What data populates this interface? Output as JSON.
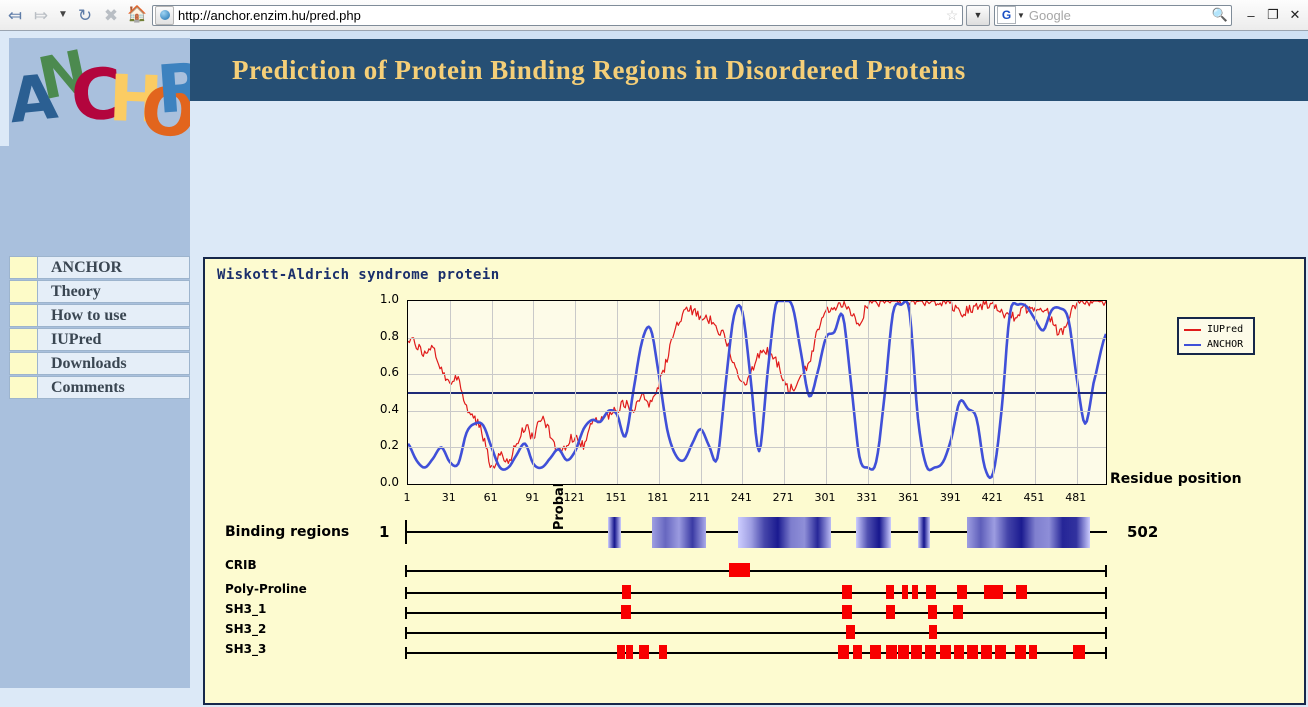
{
  "browser": {
    "back_icon": "back-arrow-icon",
    "forward_icon": "forward-arrow-icon",
    "history_icon": "history-dropdown-icon",
    "reload_icon": "reload-icon",
    "stop_icon": "stop-icon",
    "home_icon": "home-icon",
    "url": "http://anchor.enzim.hu/pred.php",
    "bookmark_icon": "star-icon",
    "url_dropdown_icon": "chevron-down-icon",
    "search_engine": "G",
    "search_placeholder": "Google",
    "search_icon": "magnifier-icon",
    "minimize": "–",
    "maximize": "❐",
    "close": "✕"
  },
  "logo": {
    "letters": [
      {
        "ch": "A",
        "color": "#2b5f92"
      },
      {
        "ch": "N",
        "color": "#4c8a4f"
      },
      {
        "ch": "C",
        "color": "#b3053d"
      },
      {
        "ch": "H",
        "color": "#fbcc63"
      },
      {
        "ch": "O",
        "color": "#e2651d"
      },
      {
        "ch": "R",
        "color": "#3d82bf"
      }
    ],
    "alt": "ANCHOR"
  },
  "header": {
    "title": "Prediction of Protein Binding Regions in Disordered Proteins",
    "title_color": "#f5cf78",
    "banner_color": "#264f74"
  },
  "sidebar": {
    "items": [
      {
        "label": "ANCHOR"
      },
      {
        "label": "Theory"
      },
      {
        "label": "How to use"
      },
      {
        "label": "IUPred"
      },
      {
        "label": "Downloads"
      },
      {
        "label": "Comments"
      }
    ]
  },
  "main": {
    "protein_name": "Wiskott-Aldrich syndrome protein",
    "binding_regions_label": "Binding regions",
    "binding_start": "1",
    "binding_end": "502"
  },
  "chart_data": {
    "type": "line",
    "title": "Wiskott-Aldrich syndrome protein",
    "xlabel": "Residue position",
    "ylabel": "Probability",
    "xlim": [
      1,
      502
    ],
    "ylim": [
      0.0,
      1.0
    ],
    "grid": true,
    "legend_position": "outside-right-top",
    "threshold": 0.5,
    "xticks": [
      1,
      31,
      61,
      91,
      121,
      151,
      181,
      211,
      241,
      271,
      301,
      331,
      361,
      391,
      421,
      451,
      481
    ],
    "yticks": [
      "0.0",
      "0.2",
      "0.4",
      "0.6",
      "0.8",
      "1.0"
    ],
    "series": [
      {
        "name": "IUPred",
        "color": "#e01b1b",
        "x": [
          1,
          7,
          13,
          19,
          25,
          31,
          37,
          43,
          49,
          55,
          61,
          67,
          73,
          79,
          85,
          91,
          97,
          103,
          109,
          115,
          121,
          127,
          133,
          139,
          145,
          151,
          157,
          163,
          169,
          175,
          181,
          187,
          193,
          199,
          205,
          211,
          217,
          223,
          229,
          235,
          241,
          247,
          253,
          259,
          265,
          271,
          277,
          283,
          289,
          295,
          301,
          307,
          313,
          319,
          325,
          331,
          337,
          343,
          349,
          355,
          361,
          367,
          373,
          379,
          385,
          391,
          397,
          403,
          409,
          415,
          421,
          427,
          433,
          439,
          445,
          451,
          457,
          463,
          469,
          475,
          481,
          487,
          493,
          502
        ],
        "values": [
          0.8,
          0.76,
          0.72,
          0.74,
          0.62,
          0.56,
          0.56,
          0.42,
          0.36,
          0.26,
          0.1,
          0.15,
          0.13,
          0.22,
          0.31,
          0.26,
          0.36,
          0.28,
          0.18,
          0.22,
          0.26,
          0.21,
          0.32,
          0.35,
          0.38,
          0.41,
          0.44,
          0.41,
          0.5,
          0.44,
          0.54,
          0.69,
          0.86,
          0.93,
          0.95,
          0.92,
          0.9,
          0.83,
          0.8,
          0.64,
          0.55,
          0.6,
          0.7,
          0.72,
          0.68,
          0.55,
          0.52,
          0.58,
          0.67,
          0.83,
          0.93,
          0.97,
          0.99,
          0.93,
          0.88,
          0.98,
          0.99,
          1.0,
          1.0,
          1.0,
          1.0,
          1.0,
          1.0,
          1.0,
          1.0,
          0.98,
          0.93,
          0.95,
          0.97,
          0.98,
          0.99,
          0.95,
          0.91,
          0.93,
          0.96,
          0.97,
          0.96,
          0.9,
          0.82,
          0.91,
          0.99,
          1.0,
          1.0,
          1.0
        ]
      },
      {
        "name": "ANCHOR",
        "color": "#4050d8",
        "x": [
          1,
          7,
          13,
          19,
          25,
          31,
          37,
          43,
          49,
          55,
          61,
          67,
          73,
          79,
          85,
          91,
          97,
          103,
          109,
          115,
          121,
          127,
          133,
          139,
          145,
          151,
          157,
          163,
          169,
          175,
          181,
          187,
          193,
          199,
          205,
          211,
          217,
          223,
          229,
          235,
          241,
          247,
          253,
          259,
          265,
          271,
          277,
          283,
          289,
          295,
          301,
          307,
          313,
          319,
          325,
          331,
          337,
          343,
          349,
          355,
          361,
          367,
          373,
          379,
          385,
          391,
          397,
          403,
          409,
          415,
          421,
          427,
          433,
          439,
          445,
          451,
          457,
          463,
          469,
          475,
          481,
          487,
          493,
          502
        ],
        "values": [
          0.22,
          0.13,
          0.09,
          0.14,
          0.2,
          0.12,
          0.11,
          0.28,
          0.33,
          0.32,
          0.2,
          0.09,
          0.09,
          0.16,
          0.22,
          0.11,
          0.09,
          0.14,
          0.19,
          0.13,
          0.18,
          0.3,
          0.35,
          0.34,
          0.4,
          0.38,
          0.26,
          0.52,
          0.78,
          0.85,
          0.6,
          0.3,
          0.16,
          0.13,
          0.22,
          0.3,
          0.21,
          0.14,
          0.55,
          0.92,
          0.94,
          0.57,
          0.18,
          0.6,
          0.98,
          1.0,
          0.97,
          0.72,
          0.48,
          0.61,
          0.8,
          0.83,
          0.92,
          0.55,
          0.15,
          0.09,
          0.12,
          0.48,
          0.93,
          0.98,
          0.94,
          0.36,
          0.1,
          0.09,
          0.12,
          0.25,
          0.45,
          0.41,
          0.36,
          0.09,
          0.06,
          0.4,
          0.93,
          0.98,
          0.97,
          0.9,
          0.84,
          0.95,
          0.96,
          0.9,
          0.58,
          0.33,
          0.55,
          0.82
        ]
      }
    ]
  },
  "binding_regions": {
    "label": "Binding regions",
    "start": 1,
    "end": 502,
    "segments": [
      {
        "start": 146,
        "end": 155
      },
      {
        "start": 177,
        "end": 216
      },
      {
        "start": 239,
        "end": 305
      },
      {
        "start": 323,
        "end": 348
      },
      {
        "start": 367,
        "end": 376
      },
      {
        "start": 402,
        "end": 490
      }
    ]
  },
  "motifs": {
    "rows": [
      {
        "name": "CRIB",
        "marks": [
          {
            "start": 232,
            "end": 247
          }
        ]
      },
      {
        "name": "Poly-Proline",
        "marks": [
          {
            "start": 156,
            "end": 162
          },
          {
            "start": 313,
            "end": 320
          },
          {
            "start": 344,
            "end": 350
          },
          {
            "start": 356,
            "end": 360
          },
          {
            "start": 363,
            "end": 367
          },
          {
            "start": 373,
            "end": 380
          },
          {
            "start": 395,
            "end": 402
          },
          {
            "start": 414,
            "end": 428
          },
          {
            "start": 437,
            "end": 445
          }
        ]
      },
      {
        "name": "SH3_1",
        "marks": [
          {
            "start": 155,
            "end": 162
          },
          {
            "start": 313,
            "end": 320
          },
          {
            "start": 344,
            "end": 351
          },
          {
            "start": 374,
            "end": 381
          },
          {
            "start": 392,
            "end": 399
          }
        ]
      },
      {
        "name": "SH3_2",
        "marks": [
          {
            "start": 316,
            "end": 322
          },
          {
            "start": 375,
            "end": 381
          }
        ]
      },
      {
        "name": "SH3_3",
        "marks": [
          {
            "start": 152,
            "end": 158
          },
          {
            "start": 159,
            "end": 164
          },
          {
            "start": 168,
            "end": 175
          },
          {
            "start": 182,
            "end": 188
          },
          {
            "start": 310,
            "end": 318
          },
          {
            "start": 321,
            "end": 327
          },
          {
            "start": 333,
            "end": 341
          },
          {
            "start": 344,
            "end": 352
          },
          {
            "start": 353,
            "end": 361
          },
          {
            "start": 362,
            "end": 370
          },
          {
            "start": 372,
            "end": 380
          },
          {
            "start": 383,
            "end": 391
          },
          {
            "start": 393,
            "end": 400
          },
          {
            "start": 402,
            "end": 410
          },
          {
            "start": 412,
            "end": 420
          },
          {
            "start": 422,
            "end": 430
          },
          {
            "start": 436,
            "end": 444
          },
          {
            "start": 446,
            "end": 452
          },
          {
            "start": 478,
            "end": 486
          }
        ]
      }
    ]
  }
}
